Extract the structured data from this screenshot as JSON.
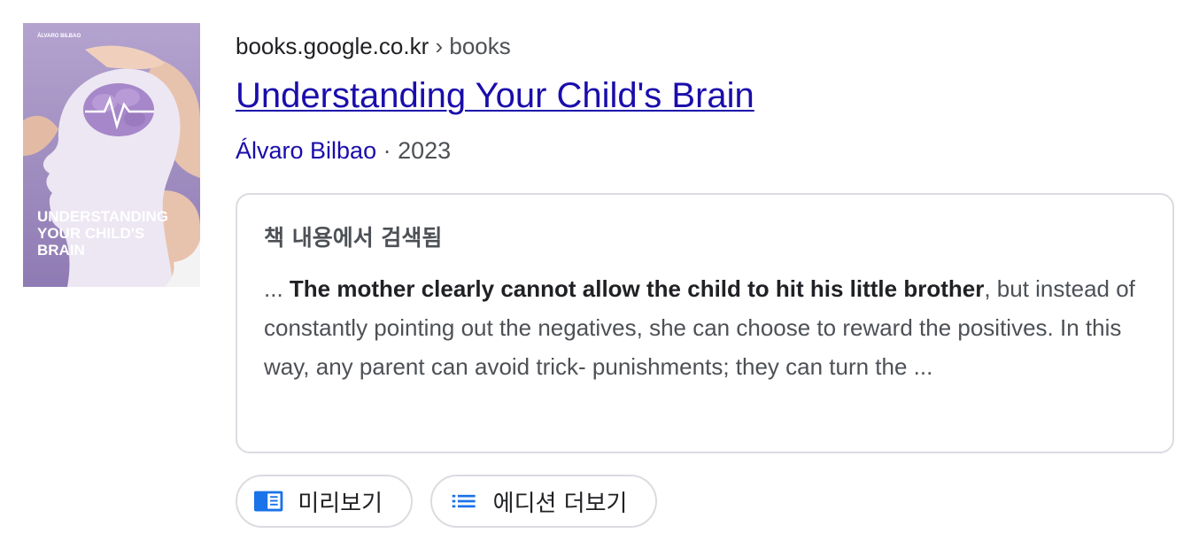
{
  "book": {
    "cover": {
      "author_text": "ÁLVARO BILBAO",
      "title_lines": [
        "UNDERSTANDING",
        "YOUR CHILD'S",
        "BRAIN"
      ],
      "background_color": "#a996c7"
    },
    "breadcrumb": {
      "domain": "books.google.co.kr",
      "separator": "›",
      "path": "books"
    },
    "title": "Understanding Your Child's Brain",
    "author": "Álvaro Bilbao",
    "meta_separator": "·",
    "year": "2023"
  },
  "snippet": {
    "label": "책 내용에서 검색됨",
    "prefix": "... ",
    "highlight": "The mother clearly cannot allow the child to hit his little brother",
    "rest": ", but instead of constantly pointing out the negatives, she can choose to reward the positives. In this way, any parent can avoid trick- punishments; they can turn the ..."
  },
  "actions": [
    {
      "label": "미리보기",
      "icon": "book-preview-icon"
    },
    {
      "label": "에디션 더보기",
      "icon": "list-icon"
    }
  ],
  "colors": {
    "link": "#1a0dab",
    "text": "#202124",
    "muted": "#4d5156",
    "border": "#dadce0",
    "icon_blue": "#1a73e8"
  }
}
